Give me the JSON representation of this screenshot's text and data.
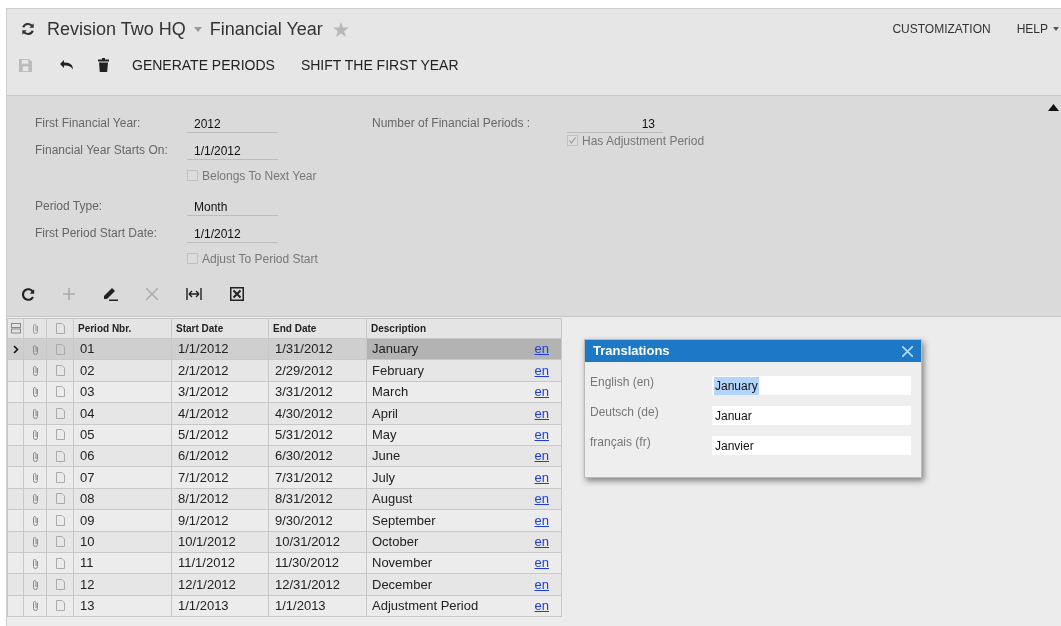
{
  "header": {
    "company": "Revision Two HQ",
    "screen": "Financial Year",
    "favorite": false,
    "links": [
      {
        "label": "CUSTOMIZATION",
        "menu": false
      },
      {
        "label": "HELP",
        "menu": true
      }
    ]
  },
  "toolbar": {
    "actions": [
      "GENERATE PERIODS",
      "SHIFT THE FIRST YEAR"
    ]
  },
  "form": {
    "left": [
      {
        "kind": "field",
        "label": "First Financial Year:",
        "value": "2012"
      },
      {
        "kind": "field",
        "label": "Financial Year Starts On:",
        "value": "1/1/2012"
      },
      {
        "kind": "checkbox",
        "label": "Belongs To Next Year",
        "checked": false
      },
      {
        "kind": "field",
        "label": "Period Type:",
        "value": "Month"
      },
      {
        "kind": "field",
        "label": "First Period Start Date:",
        "value": "1/1/2012"
      },
      {
        "kind": "checkbox",
        "label": "Adjust To Period Start",
        "checked": false
      }
    ],
    "right": [
      {
        "kind": "field",
        "label": "Number of Financial Periods :",
        "value": "13"
      },
      {
        "kind": "checkbox",
        "label": "Has Adjustment Period",
        "checked": true
      }
    ]
  },
  "grid": {
    "columns": [
      "Period Nbr.",
      "Start Date",
      "End Date",
      "Description"
    ],
    "rows": [
      {
        "period": "01",
        "start": "1/1/2012",
        "end": "1/31/2012",
        "description": "January",
        "lang": "en",
        "selected": true
      },
      {
        "period": "02",
        "start": "2/1/2012",
        "end": "2/29/2012",
        "description": "February",
        "lang": "en",
        "selected": false
      },
      {
        "period": "03",
        "start": "3/1/2012",
        "end": "3/31/2012",
        "description": "March",
        "lang": "en",
        "selected": false
      },
      {
        "period": "04",
        "start": "4/1/2012",
        "end": "4/30/2012",
        "description": "April",
        "lang": "en",
        "selected": false
      },
      {
        "period": "05",
        "start": "5/1/2012",
        "end": "5/31/2012",
        "description": "May",
        "lang": "en",
        "selected": false
      },
      {
        "period": "06",
        "start": "6/1/2012",
        "end": "6/30/2012",
        "description": "June",
        "lang": "en",
        "selected": false
      },
      {
        "period": "07",
        "start": "7/1/2012",
        "end": "7/31/2012",
        "description": "July",
        "lang": "en",
        "selected": false
      },
      {
        "period": "08",
        "start": "8/1/2012",
        "end": "8/31/2012",
        "description": "August",
        "lang": "en",
        "selected": false
      },
      {
        "period": "09",
        "start": "9/1/2012",
        "end": "9/30/2012",
        "description": "September",
        "lang": "en",
        "selected": false
      },
      {
        "period": "10",
        "start": "10/1/2012",
        "end": "10/31/2012",
        "description": "October",
        "lang": "en",
        "selected": false
      },
      {
        "period": "11",
        "start": "11/1/2012",
        "end": "11/30/2012",
        "description": "November",
        "lang": "en",
        "selected": false
      },
      {
        "period": "12",
        "start": "12/1/2012",
        "end": "12/31/2012",
        "description": "December",
        "lang": "en",
        "selected": false
      },
      {
        "period": "13",
        "start": "1/1/2013",
        "end": "1/1/2013",
        "description": "Adjustment Period",
        "lang": "en",
        "selected": false
      }
    ]
  },
  "translations": {
    "title": "Translations",
    "rows": [
      {
        "label": "English (en)",
        "value": "January",
        "highlighted": true
      },
      {
        "label": "Deutsch (de)",
        "value": "Januar",
        "highlighted": false
      },
      {
        "label": "français (fr)",
        "value": "Janvier",
        "highlighted": false
      }
    ]
  }
}
